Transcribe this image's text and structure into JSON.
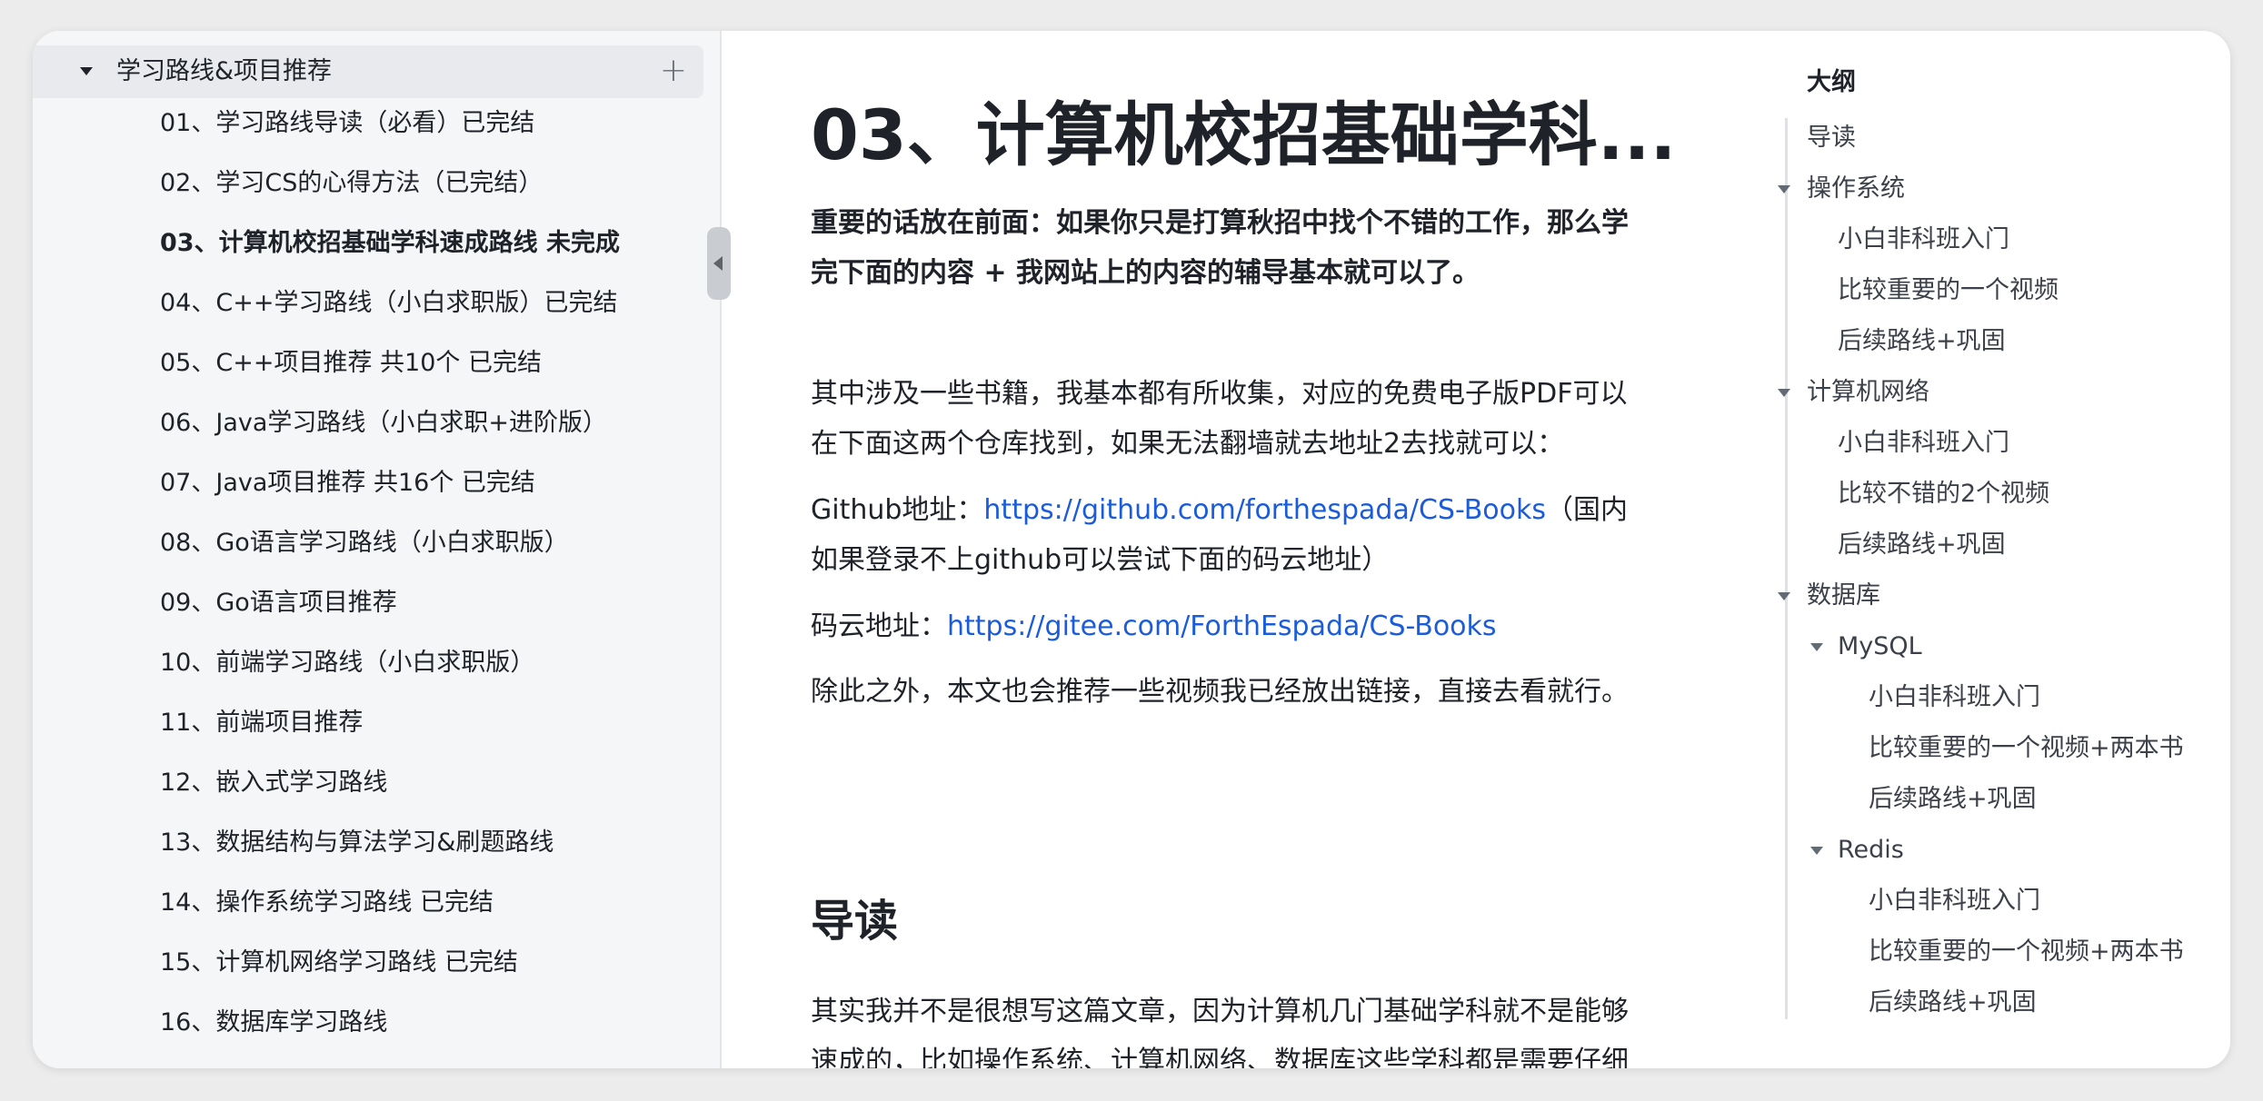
{
  "sidebar": {
    "group_label": "学习路线&项目推荐",
    "items": [
      {
        "label": "01、学习路线导读（必看）已完结"
      },
      {
        "label": "02、学习CS的心得方法（已完结）"
      },
      {
        "label": "03、计算机校招基础学科速成路线 未完成"
      },
      {
        "label": "04、C++学习路线（小白求职版）已完结"
      },
      {
        "label": "05、C++项目推荐 共10个 已完结"
      },
      {
        "label": "06、Java学习路线（小白求职+进阶版）"
      },
      {
        "label": "07、Java项目推荐 共16个 已完结"
      },
      {
        "label": "08、Go语言学习路线（小白求职版）"
      },
      {
        "label": "09、Go语言项目推荐"
      },
      {
        "label": "10、前端学习路线（小白求职版）"
      },
      {
        "label": "11、前端项目推荐"
      },
      {
        "label": "12、嵌入式学习路线"
      },
      {
        "label": "13、数据结构与算法学习&刷题路线"
      },
      {
        "label": "14、操作系统学习路线 已完结"
      },
      {
        "label": "15、计算机网络学习路线 已完结"
      },
      {
        "label": "16、数据库学习路线"
      }
    ]
  },
  "article": {
    "title": "03、计算机校招基础学科...",
    "intro_bold": "重要的话放在前面：如果你只是打算秋招中找个不错的工作，那么学完下面的内容 + 我网站上的内容的辅导基本就可以了。",
    "para_books": "其中涉及一些书籍，我基本都有所收集，对应的免费电子版PDF可以在下面这两个仓库找到，如果无法翻墙就去地址2去找就可以：",
    "github_prefix": "Github地址：",
    "github_link": "https://github.com/forthespada/CS-Books",
    "github_suffix": "（国内如果登录不上github可以尝试下面的码云地址）",
    "gitee_prefix": "码云地址：",
    "gitee_link": "https://gitee.com/ForthEspada/CS-Books",
    "para_videos": "除此之外，本文也会推荐一些视频我已经放出链接，直接去看就行。",
    "h2_intro": "导读",
    "para_intro": "其实我并不是很想写这篇文章，因为计算机几门基础学科就不是能够速成的，比如操作系统、计算机网络、数据库这些学科都是需要仔细"
  },
  "outline": {
    "title": "大纲",
    "items": [
      {
        "label": "导读"
      },
      {
        "label": "操作系统"
      },
      {
        "label": "小白非科班入门"
      },
      {
        "label": "比较重要的一个视频"
      },
      {
        "label": "后续路线+巩固"
      },
      {
        "label": "计算机网络"
      },
      {
        "label": "小白非科班入门"
      },
      {
        "label": "比较不错的2个视频"
      },
      {
        "label": "后续路线+巩固"
      },
      {
        "label": "数据库"
      },
      {
        "label": "MySQL"
      },
      {
        "label": "小白非科班入门"
      },
      {
        "label": "比较重要的一个视频+两本书"
      },
      {
        "label": "后续路线+巩固"
      },
      {
        "label": "Redis"
      },
      {
        "label": "小白非科班入门"
      },
      {
        "label": "比较重要的一个视频+两本书"
      },
      {
        "label": "后续路线+巩固"
      }
    ]
  },
  "colors": {
    "link": "#1a5cdb",
    "sidebar_bg": "#f5f6f7",
    "selected_row_bg": "#e8eaed",
    "text": "#1f2329"
  }
}
